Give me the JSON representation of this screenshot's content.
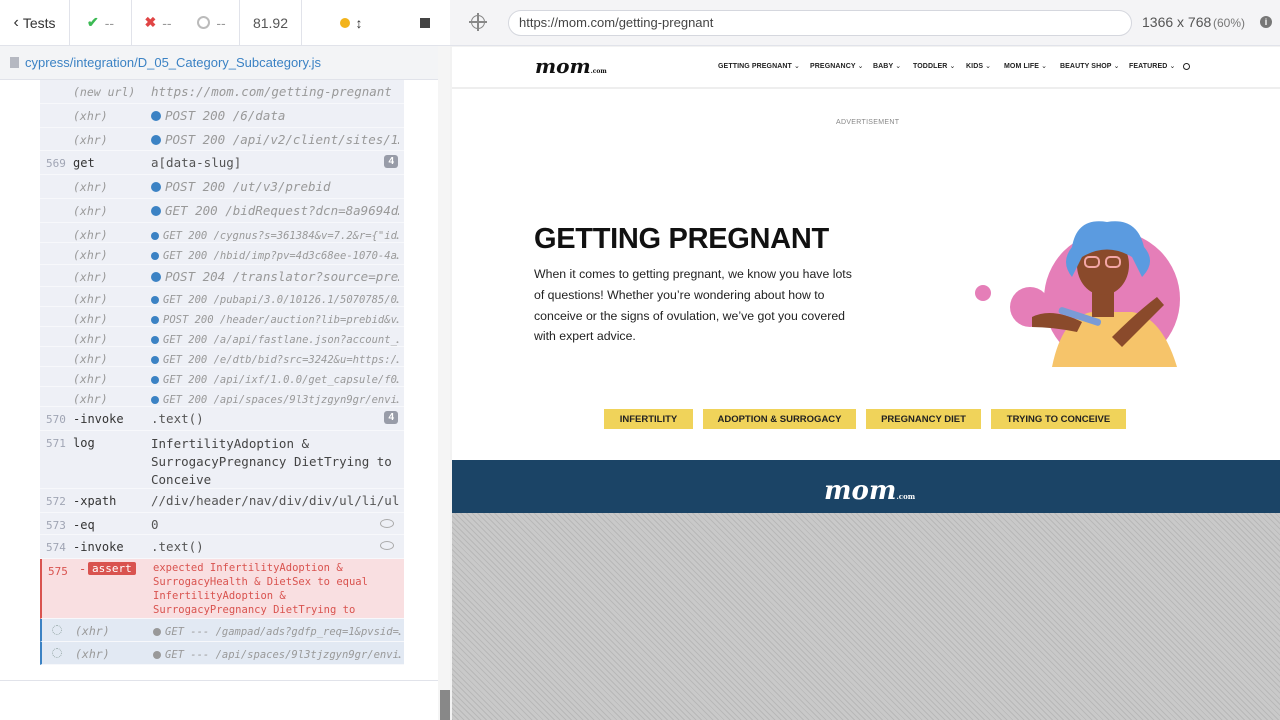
{
  "runner": {
    "back_label": "Tests",
    "passed": "--",
    "failed": "--",
    "pending": "--",
    "duration": "81.92",
    "spec_file": "cypress/integration/D_05_Category_Subcategory.js"
  },
  "log": {
    "rows": [
      {
        "num": "",
        "cmd": "(new url)",
        "msg": "https://mom.com/getting-pregnant",
        "type": "meta"
      },
      {
        "num": "",
        "cmd": "(xhr)",
        "msg": "POST 200 /6/data",
        "type": "xhr"
      },
      {
        "num": "",
        "cmd": "(xhr)",
        "msg": "POST 200 /api/v2/client/sites/1…",
        "type": "xhr"
      },
      {
        "num": "569",
        "cmd": "get",
        "msg": "a[data-slug]",
        "badge": "4",
        "type": "cmd"
      },
      {
        "num": "",
        "cmd": "(xhr)",
        "msg": "POST 200 /ut/v3/prebid",
        "type": "xhr"
      },
      {
        "num": "",
        "cmd": "(xhr)",
        "msg": "GET 200 /bidRequest?dcn=8a9694d…",
        "type": "xhr"
      },
      {
        "num": "",
        "cmd": "(xhr)",
        "msg": "GET 200 /cygnus?s=361384&v=7.2&r={\"id…",
        "type": "xhr-sm"
      },
      {
        "num": "",
        "cmd": "(xhr)",
        "msg": "GET 200 /hbid/imp?pv=4d3c68ee-1070-4a…",
        "type": "xhr-sm"
      },
      {
        "num": "",
        "cmd": "(xhr)",
        "msg": "POST 204 /translator?source=pre…",
        "type": "xhr"
      },
      {
        "num": "",
        "cmd": "(xhr)",
        "msg": "GET 200 /pubapi/3.0/10126.1/5070785/0…",
        "type": "xhr-sm"
      },
      {
        "num": "",
        "cmd": "(xhr)",
        "msg": "POST 200 /header/auction?lib=prebid&v…",
        "type": "xhr-sm"
      },
      {
        "num": "",
        "cmd": "(xhr)",
        "msg": "GET 200 /a/api/fastlane.json?account_…",
        "type": "xhr-sm"
      },
      {
        "num": "",
        "cmd": "(xhr)",
        "msg": "GET 200 /e/dtb/bid?src=3242&u=https:/…",
        "type": "xhr-sm"
      },
      {
        "num": "",
        "cmd": "(xhr)",
        "msg": "GET 200 /api/ixf/1.0.0/get_capsule/f0…",
        "type": "xhr-sm"
      },
      {
        "num": "",
        "cmd": "(xhr)",
        "msg": "GET 200 /api/spaces/9l3tjzgyn9gr/envi…",
        "type": "xhr-sm"
      },
      {
        "num": "570",
        "cmd": "-invoke",
        "msg": ".text()",
        "badge": "4",
        "type": "cmd"
      },
      {
        "num": "571",
        "cmd": "log",
        "msg": "InfertilityAdoption & SurrogacyPregnancy DietTrying to Conceive",
        "type": "log"
      },
      {
        "num": "572",
        "cmd": "-xpath",
        "msg": "//div/header/nav/div/div/ul/li/ul",
        "type": "cmd"
      },
      {
        "num": "573",
        "cmd": "-eq",
        "msg": "0",
        "eye": true,
        "type": "cmd"
      },
      {
        "num": "574",
        "cmd": "-invoke",
        "msg": ".text()",
        "eye": true,
        "type": "cmd"
      },
      {
        "num": "575",
        "cmd": "assert",
        "msg": "expected  InfertilityAdoption & SurrogacyHealth & DietSex  to equal  InfertilityAdoption & SurrogacyPregnancy DietTrying to Conceive",
        "type": "assert"
      },
      {
        "num": "",
        "cmd": "(xhr)",
        "msg": "GET --- /gampad/ads?gdfp_req=1&pvsid=…",
        "type": "pending"
      },
      {
        "num": "",
        "cmd": "(xhr)",
        "msg": "GET --- /api/spaces/9l3tjzgyn9gr/envi…",
        "type": "pending"
      }
    ]
  },
  "browser": {
    "url": "https://mom.com/getting-pregnant",
    "viewport": "1366 x 768",
    "zoom": "(60%)"
  },
  "site": {
    "logo": "mom",
    "logo_suffix": ".com",
    "nav": [
      "GETTING PREGNANT",
      "PREGNANCY",
      "BABY",
      "TODDLER",
      "KIDS",
      "MOM LIFE",
      "BEAUTY SHOP",
      "FEATURED"
    ],
    "ad_label": "ADVERTISEMENT",
    "title": "GETTING PREGNANT",
    "description": "When it comes to getting pregnant, we know you have lots of questions! Whether you’re wondering about how to conceive or the signs of ovulation, we’ve got you covered with expert advice.",
    "tags": [
      "INFERTILITY",
      "ADOPTION & SURROGACY",
      "PREGNANCY DIET",
      "TRYING TO CONCEIVE"
    ],
    "footer_logo": "mom",
    "footer_suffix": ".com"
  },
  "colors": {
    "accent_blue": "#3b82c4",
    "error_red": "#d9534f",
    "pill_yellow": "#f0d35a",
    "footer_navy": "#1b4466"
  }
}
